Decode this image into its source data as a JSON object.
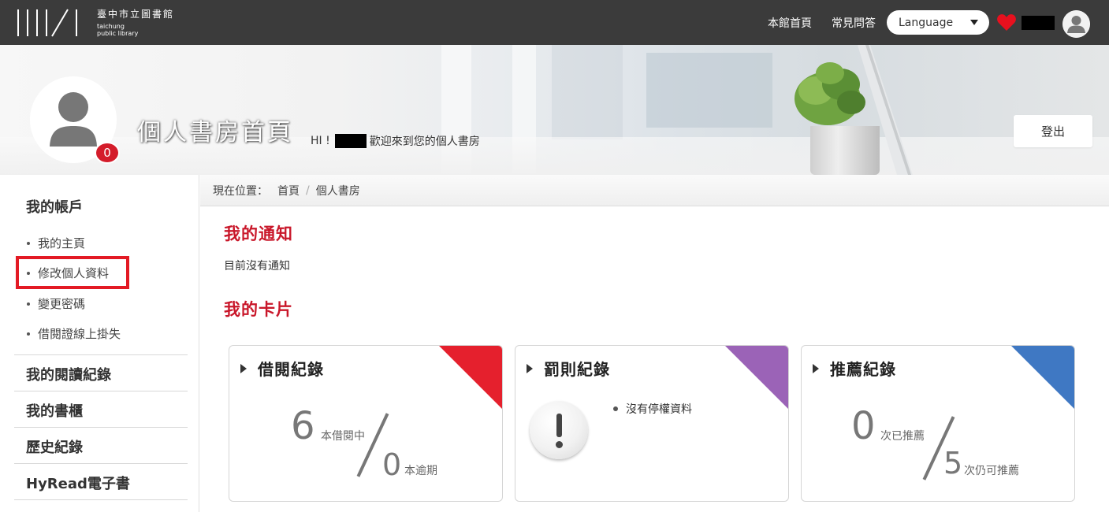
{
  "header": {
    "logo_zh": "臺中市立圖書館",
    "logo_en_line1": "taichung",
    "logo_en_line2": "public library",
    "nav_home": "本館首頁",
    "nav_faq": "常見問答",
    "language_label": "Language"
  },
  "profile": {
    "notification_count": "0",
    "page_title": "個人書房首頁",
    "greeting_prefix": "HI !",
    "greeting_suffix": "歡迎來到您的個人書房",
    "logout_label": "登出"
  },
  "breadcrumb": {
    "label": "現在位置：",
    "home": "首頁",
    "separator": "/",
    "current": "個人書房"
  },
  "sidebar": {
    "account_heading": "我的帳戶",
    "account_items": [
      {
        "label": "我的主頁"
      },
      {
        "label": "修改個人資料"
      },
      {
        "label": "變更密碼"
      },
      {
        "label": "借閱證線上掛失"
      }
    ],
    "sections": [
      {
        "label": "我的閱讀紀錄"
      },
      {
        "label": "我的書櫃"
      },
      {
        "label": "歷史紀錄"
      },
      {
        "label": "HyRead電子書"
      }
    ]
  },
  "main": {
    "notifications_title": "我的通知",
    "no_notifications": "目前沒有通知",
    "cards_title": "我的卡片",
    "cards": {
      "borrow": {
        "title": "借閱紀錄",
        "borrowed_count": "6",
        "borrowed_label": "本借閱中",
        "overdue_count": "0",
        "overdue_label": "本逾期",
        "accent": "#e5202d"
      },
      "penalty": {
        "title": "罰則紀錄",
        "status": "沒有停權資料",
        "accent": "#9b63b7"
      },
      "recommend": {
        "title": "推薦紀錄",
        "recommended_count": "0",
        "recommended_label": "次已推薦",
        "remaining_count": "5",
        "remaining_label": "次仍可推薦",
        "accent": "#3f78c3"
      }
    }
  },
  "colors": {
    "header_bg": "#3b3b3b",
    "brand_red": "#c9172a",
    "highlight": "#e31a24"
  }
}
